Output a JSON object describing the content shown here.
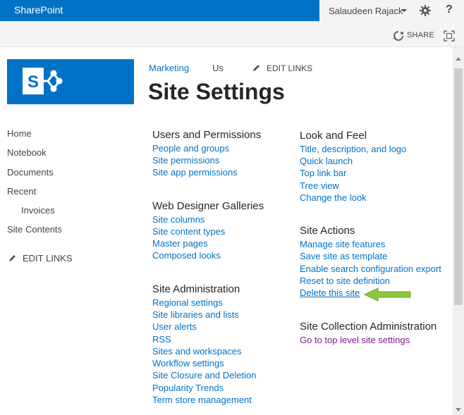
{
  "suite_bar": {
    "brand": "SharePoint",
    "user_name": "Salaudeen Rajack",
    "help": "?"
  },
  "ribbon": {
    "share_label": "SHARE"
  },
  "top_nav": {
    "items": [
      "Marketing",
      "Us"
    ],
    "edit_links": "EDIT LINKS"
  },
  "page_title": "Site Settings",
  "quick_launch": {
    "items": [
      "Home",
      "Notebook",
      "Documents",
      "Recent",
      "Invoices",
      "Site Contents"
    ],
    "edit_links": "EDIT LINKS"
  },
  "sections": {
    "users_permissions": {
      "title": "Users and Permissions",
      "links": [
        "People and groups",
        "Site permissions",
        "Site app permissions"
      ]
    },
    "web_designer": {
      "title": "Web Designer Galleries",
      "links": [
        "Site columns",
        "Site content types",
        "Master pages",
        "Composed looks"
      ]
    },
    "site_admin": {
      "title": "Site Administration",
      "links": [
        "Regional settings",
        "Site libraries and lists",
        "User alerts",
        "RSS",
        "Sites and workspaces",
        "Workflow settings",
        "Site Closure and Deletion",
        "Popularity Trends",
        "Term store management"
      ]
    },
    "look_feel": {
      "title": "Look and Feel",
      "links": [
        "Title, description, and logo",
        "Quick launch",
        "Top link bar",
        "Tree view",
        "Change the look"
      ]
    },
    "site_actions": {
      "title": "Site Actions",
      "links": [
        "Manage site features",
        "Save site as template",
        "Enable search configuration export",
        "Reset to site definition",
        "Delete this site"
      ]
    },
    "site_collection": {
      "title": "Site Collection Administration",
      "links": [
        "Go to top level site settings"
      ]
    }
  },
  "colors": {
    "brand_blue": "#0072c6",
    "link": "#0072c6",
    "visited_link": "#7d1e8c",
    "arrow": "#8cc63f"
  }
}
